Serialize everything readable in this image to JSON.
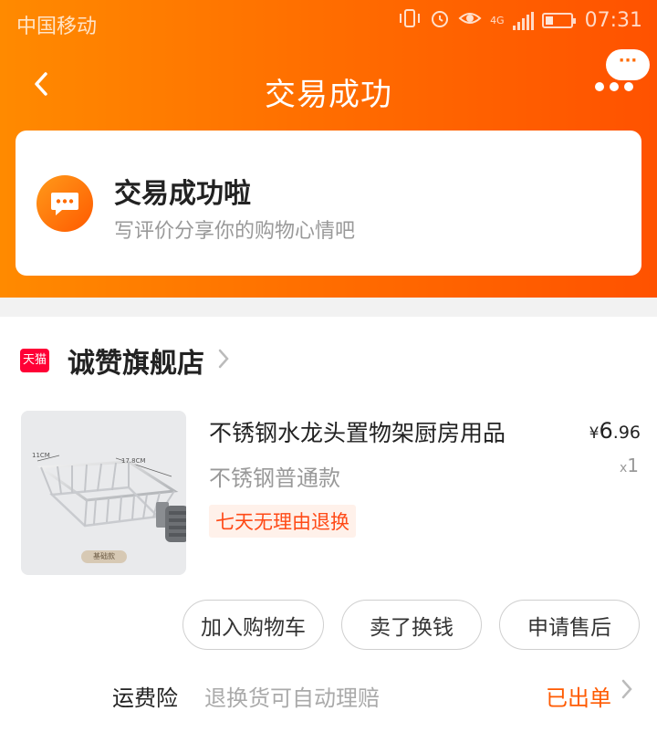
{
  "status_bar": {
    "carrier": "中国移动",
    "network": "4G",
    "time": "07:31",
    "battery_level": 0.3,
    "icons": [
      "vibrate-icon",
      "alarm-icon",
      "eye-care-icon",
      "network-4g-icon",
      "signal-icon",
      "battery-icon"
    ]
  },
  "nav": {
    "title": "交易成功",
    "back_icon": "‹",
    "more_bubble": "···"
  },
  "success_card": {
    "title": "交易成功啦",
    "subtitle": "写评价分享你的购物心情吧"
  },
  "order": {
    "shop_badge": "天猫",
    "shop_name": "诚赞旗舰店",
    "product": {
      "title": "不锈钢水龙头置物架厨房用品",
      "price_currency": "¥",
      "price_int": "6",
      "price_dec": ".96",
      "sku": "不锈钢普通款",
      "qty_prefix": "x",
      "qty": "1",
      "return_policy": "七天无理由退换",
      "image_labels": {
        "width": "11CM",
        "length": "17.8CM",
        "tag": "基础款"
      }
    },
    "actions": {
      "add_to_cart": "加入购物车",
      "resell": "卖了换钱",
      "after_sale": "申请售后"
    },
    "insurance": {
      "label": "运费险",
      "description": "退换货可自动理赔",
      "status": "已出单"
    }
  },
  "colors": {
    "header_start": "#ff8a00",
    "header_end": "#ff5200",
    "accent": "#ff5a00",
    "tmall_red": "#ff0036"
  }
}
